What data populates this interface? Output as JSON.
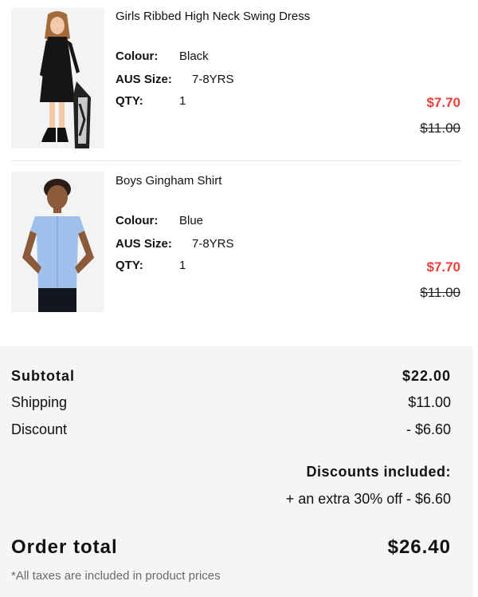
{
  "items": [
    {
      "name": "Girls Ribbed High Neck Swing Dress",
      "colour_label": "Colour:",
      "colour": "Black",
      "size_label": "AUS Size:",
      "size": "7-8YRS",
      "qty_label": "QTY:",
      "qty": "1",
      "price_now": "$7.70",
      "price_was": "$11.00",
      "image": "girl-in-black-dress-photo"
    },
    {
      "name": "Boys Gingham Shirt",
      "colour_label": "Colour:",
      "colour": "Blue",
      "size_label": "AUS Size:",
      "size": "7-8YRS",
      "qty_label": "QTY:",
      "qty": "1",
      "price_now": "$7.70",
      "price_was": "$11.00",
      "image": "boy-in-blue-shirt-photo"
    }
  ],
  "summary": {
    "subtotal_label": "Subtotal",
    "subtotal": "$22.00",
    "shipping_label": "Shipping",
    "shipping": "$11.00",
    "discount_label": "Discount",
    "discount": "- $6.60",
    "discounts_included_label": "Discounts included:",
    "discounts_included_line": "+ an extra 30% off - $6.60",
    "order_total_label": "Order total",
    "order_total": "$26.40",
    "tax_note": "*All taxes are included in product prices"
  },
  "colors": {
    "sale_price": "#e8413a",
    "summary_bg": "#f5f5f5"
  }
}
